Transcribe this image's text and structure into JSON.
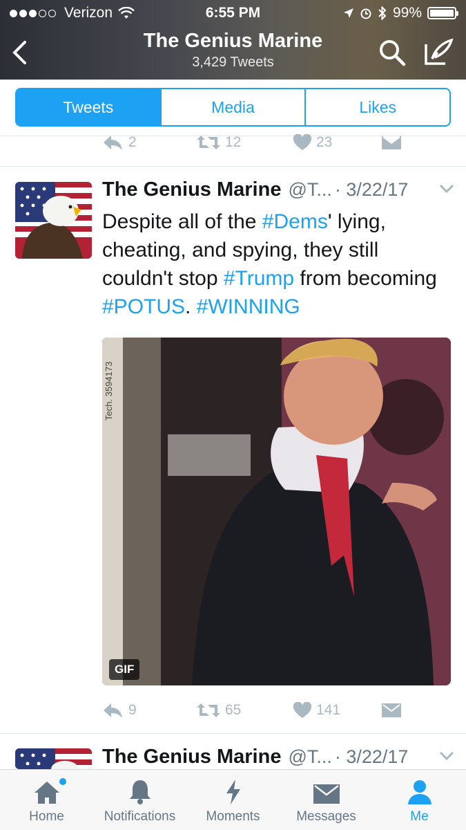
{
  "status_bar": {
    "carrier": "Verizon",
    "time": "6:55 PM",
    "battery": "99%"
  },
  "nav": {
    "title": "The Genius Marine",
    "subtitle": "3,429 Tweets"
  },
  "tabs": [
    {
      "label": "Tweets",
      "active": true
    },
    {
      "label": "Media",
      "active": false
    },
    {
      "label": "Likes",
      "active": false
    }
  ],
  "prev_tweet_actions": {
    "replies": "2",
    "retweets": "12",
    "likes": "23"
  },
  "tweet": {
    "name": "The Genius Marine",
    "handle": "@T...",
    "date": "· 3/22/17",
    "text_parts": [
      {
        "t": "Despite all of the "
      },
      {
        "t": "#Dems",
        "tag": true
      },
      {
        "t": "' lying, cheating, and spying, they still couldn't stop "
      },
      {
        "t": "#Trump",
        "tag": true
      },
      {
        "t": " from becoming "
      },
      {
        "t": "#POTUS",
        "tag": true
      },
      {
        "t": ".  "
      },
      {
        "t": "#WINNING",
        "tag": true
      }
    ],
    "media_badge": "GIF",
    "replies": "9",
    "retweets": "65",
    "likes": "141"
  },
  "next_tweet": {
    "name": "The Genius Marine",
    "handle": "@T...",
    "date": "· 3/22/17"
  },
  "bottom_tabs": [
    {
      "label": "Home",
      "icon": "home-icon"
    },
    {
      "label": "Notifications",
      "icon": "bell-icon"
    },
    {
      "label": "Moments",
      "icon": "lightning-icon"
    },
    {
      "label": "Messages",
      "icon": "envelope-icon"
    },
    {
      "label": "Me",
      "icon": "person-icon",
      "active": true
    }
  ],
  "colors": {
    "accent": "#1da1f2",
    "muted": "#aab8c2",
    "text": "#14171a"
  }
}
